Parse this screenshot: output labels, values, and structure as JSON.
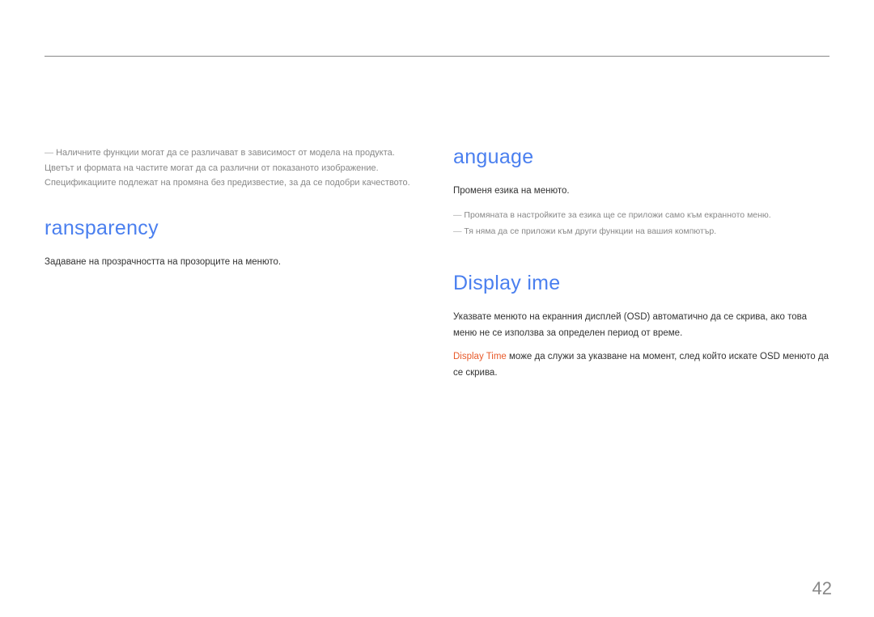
{
  "left": {
    "topNote": "Наличните функции могат да се различават в зависимост от модела на продукта. Цветът и формата на частите могат да са различни от показаното изображение. Спецификациите подлежат на промяна без предизвестие, за да се подобри качеството.",
    "heading1": "ransparency",
    "body1": "Задаване на прозрачността на прозорците на менюто."
  },
  "right": {
    "heading1": "anguage",
    "body1": "Променя езика на менюто.",
    "note1": "Промяната в настройките за езика ще се приложи само към екранното меню.",
    "note2": "Тя няма да се приложи към други функции на вашия компютър.",
    "heading2": "Display ime",
    "body2": "Указвате менюто на екранния дисплей (OSD) автоматично да се скрива, ако това меню не се използва за определен период от време.",
    "highlightLabel": "Display Time",
    "body3": " може да служи за указване на момент, след който искате OSD менюто да се скрива."
  },
  "pageNumber": "42"
}
